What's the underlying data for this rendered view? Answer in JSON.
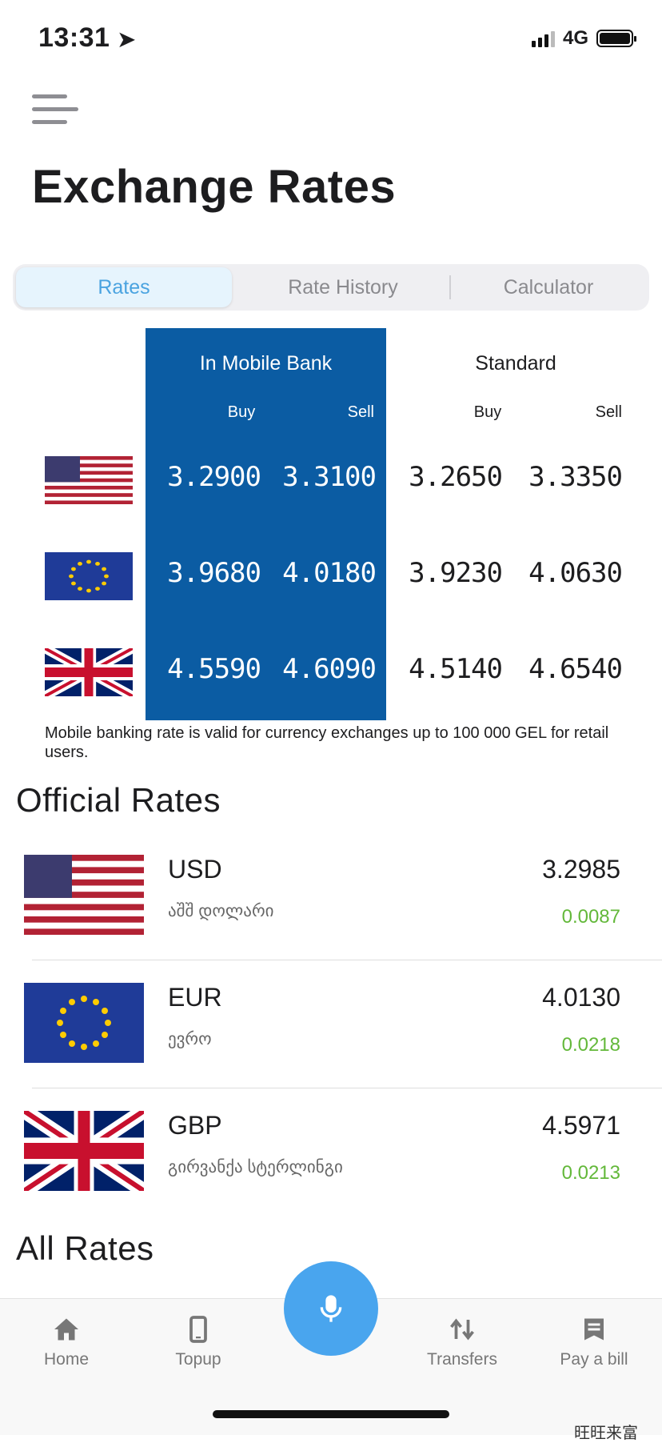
{
  "status": {
    "time": "13:31",
    "network": "4G"
  },
  "title": "Exchange Rates",
  "tabs": [
    {
      "label": "Rates",
      "active": true
    },
    {
      "label": "Rate History",
      "active": false
    },
    {
      "label": "Calculator",
      "active": false
    }
  ],
  "rates_table": {
    "mobile_header": "In Mobile Bank",
    "standard_header": "Standard",
    "buy_label": "Buy",
    "sell_label": "Sell",
    "rows": [
      {
        "flag": "us-flag-icon",
        "mobile_buy": "3.2900",
        "mobile_sell": "3.3100",
        "std_buy": "3.2650",
        "std_sell": "3.3350"
      },
      {
        "flag": "eu-flag-icon",
        "mobile_buy": "3.9680",
        "mobile_sell": "4.0180",
        "std_buy": "3.9230",
        "std_sell": "4.0630"
      },
      {
        "flag": "gb-flag-icon",
        "mobile_buy": "4.5590",
        "mobile_sell": "4.6090",
        "std_buy": "4.5140",
        "std_sell": "4.6540"
      }
    ],
    "note": "Mobile banking rate is valid for currency exchanges up to 100 000 GEL for retail users."
  },
  "official": {
    "title": "Official Rates",
    "rows": [
      {
        "flag": "us-flag-icon",
        "code": "USD",
        "name": "აშშ დოლარი",
        "rate": "3.2985",
        "change": "0.0087"
      },
      {
        "flag": "eu-flag-icon",
        "code": "EUR",
        "name": "ევრო",
        "rate": "4.0130",
        "change": "0.0218"
      },
      {
        "flag": "gb-flag-icon",
        "code": "GBP",
        "name": "გირვანქა სტერლინგი",
        "rate": "4.5971",
        "change": "0.0213"
      }
    ]
  },
  "all_rates_title": "All Rates",
  "nav": {
    "home": "Home",
    "topup": "Topup",
    "transfers": "Transfers",
    "pay_bill": "Pay a bill",
    "mic_icon": "microphone-icon"
  },
  "watermark": "旺旺来富",
  "colors": {
    "mobile_panel": "#0b5ca3",
    "active_tab": "#4aa3e0",
    "positive_change": "#63b83a",
    "mic_button": "#49a5ee"
  }
}
